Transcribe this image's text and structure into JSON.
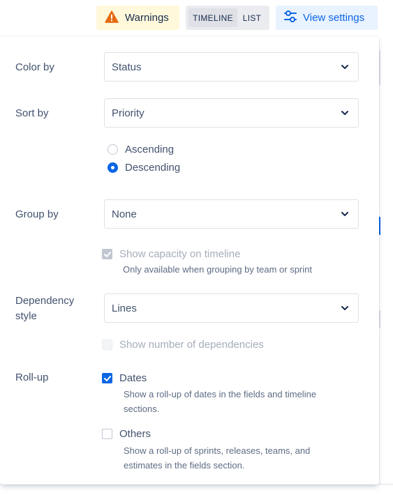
{
  "toolbar": {
    "warnings_label": "Warnings",
    "view_toggle": {
      "options": [
        "TIMELINE",
        "LIST"
      ],
      "selected": "TIMELINE"
    },
    "view_settings_label": "View settings"
  },
  "settings": {
    "color_by": {
      "label": "Color by",
      "value": "Status"
    },
    "sort_by": {
      "label": "Sort by",
      "value": "Priority",
      "order_options": [
        {
          "label": "Ascending",
          "checked": false
        },
        {
          "label": "Descending",
          "checked": true
        }
      ]
    },
    "group_by": {
      "label": "Group by",
      "value": "None",
      "show_capacity": {
        "label": "Show capacity on timeline",
        "checked": true,
        "disabled": true,
        "help": "Only available when grouping by team or sprint"
      }
    },
    "dependency_style": {
      "label_line1": "Dependency",
      "label_line2": "style",
      "value": "Lines",
      "show_number": {
        "label": "Show number of dependencies",
        "checked": false,
        "disabled": true
      }
    },
    "roll_up": {
      "label": "Roll-up",
      "dates": {
        "label": "Dates",
        "checked": true,
        "help_line1": "Show a roll-up of dates in the fields and timeline",
        "help_line2": "sections."
      },
      "others": {
        "label": "Others",
        "checked": false,
        "help_line1": "Show a roll-up of sprints, releases, teams, and",
        "help_line2": "estimates in the fields section."
      }
    }
  },
  "colors": {
    "accent": "#0C66E4",
    "warning_bg": "#FFF8DB",
    "warning_icon": "#E56910",
    "toggle_bg": "#EBECF0"
  }
}
